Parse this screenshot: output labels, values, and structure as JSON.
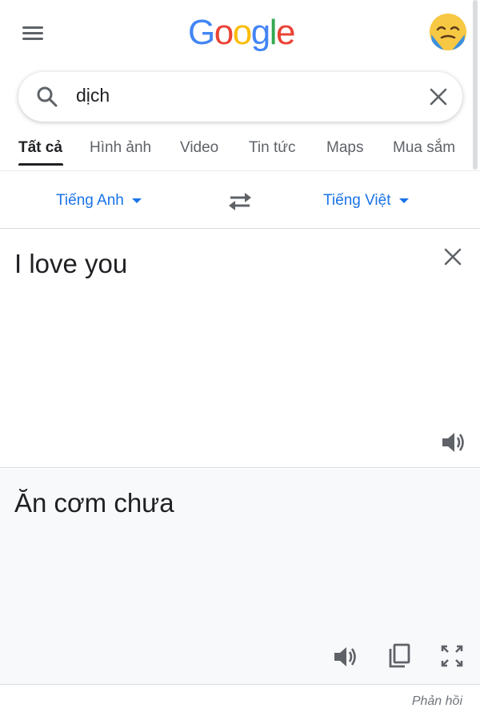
{
  "header": {
    "menu_icon": "hamburger-menu-icon",
    "logo_letters": [
      {
        "char": "G",
        "color": "#4285F4"
      },
      {
        "char": "o",
        "color": "#EA4335"
      },
      {
        "char": "o",
        "color": "#FBBC05"
      },
      {
        "char": "g",
        "color": "#4285F4"
      },
      {
        "char": "l",
        "color": "#34A853"
      },
      {
        "char": "e",
        "color": "#EA4335"
      }
    ],
    "avatar_icon": "emoji-avatar-icon"
  },
  "search": {
    "query": "dịch",
    "search_icon": "search-icon",
    "clear_icon": "close-icon"
  },
  "tabs": [
    {
      "label": "Tất cả",
      "active": true
    },
    {
      "label": "Hình ảnh",
      "active": false
    },
    {
      "label": "Video",
      "active": false
    },
    {
      "label": "Tin tức",
      "active": false
    },
    {
      "label": "Maps",
      "active": false
    },
    {
      "label": "Mua sắm",
      "active": false
    }
  ],
  "translator": {
    "source_language": "Tiếng Anh",
    "target_language": "Tiếng Việt",
    "source_text": "I love you",
    "translated_text": "Ăn cơm chưa",
    "feedback_label": "Phản hồi"
  },
  "colors": {
    "accent": "#1a73e8",
    "icon_gray": "#5f6368",
    "result_background": "#f8f9fa"
  }
}
